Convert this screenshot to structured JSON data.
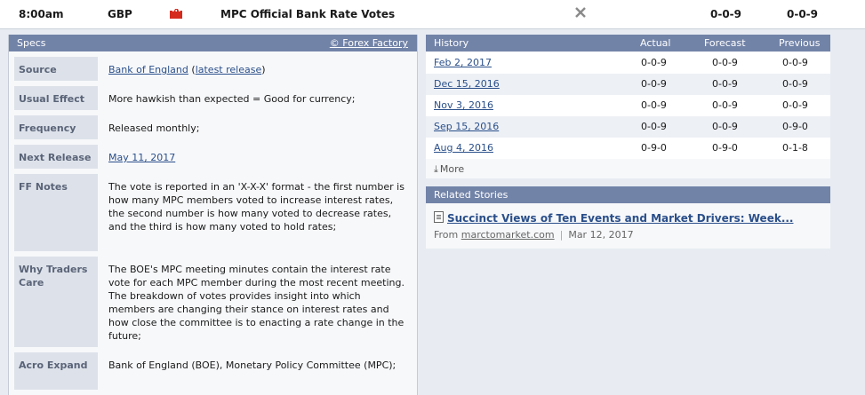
{
  "event": {
    "time": "8:00am",
    "currency": "GBP",
    "impact_color": "#d52b1e",
    "title": "MPC Official Bank Rate Votes",
    "detail_icon": "close-x-icon",
    "actual": "0-0-9",
    "forecast": "0-0-9"
  },
  "specs": {
    "header": "Specs",
    "credit": "© Forex Factory",
    "rows": [
      {
        "label": "Source",
        "link": "Bank of England",
        "open": " (",
        "link2": "latest release",
        "close": ")"
      },
      {
        "label": "Usual Effect",
        "value": "More hawkish than expected = Good for currency;"
      },
      {
        "label": "Frequency",
        "value": "Released monthly;"
      },
      {
        "label": "Next Release",
        "link": "May 11, 2017"
      },
      {
        "label": "FF Notes",
        "value": "The vote is reported in an 'X-X-X' format - the first number is how many MPC members voted to increase interest rates, the second number is how many voted to decrease rates, and the third is how many voted to hold rates;"
      },
      {
        "label": "Why Traders Care",
        "value": "The BOE's MPC meeting minutes contain the interest rate vote for each MPC member during the most recent meeting. The breakdown of votes provides insight into which members are changing their stance on interest rates and how close the committee is to enacting a rate change in the future;"
      },
      {
        "label": "Acro Expand",
        "value": "Bank of England (BOE), Monetary Policy Committee (MPC);"
      }
    ]
  },
  "history": {
    "header": "History",
    "col_actual": "Actual",
    "col_forecast": "Forecast",
    "col_previous": "Previous",
    "rows": [
      {
        "date": "Feb 2, 2017",
        "actual": "0-0-9",
        "forecast": "0-0-9",
        "previous": "0-0-9"
      },
      {
        "date": "Dec 15, 2016",
        "actual": "0-0-9",
        "forecast": "0-0-9",
        "previous": "0-0-9"
      },
      {
        "date": "Nov 3, 2016",
        "actual": "0-0-9",
        "forecast": "0-0-9",
        "previous": "0-0-9"
      },
      {
        "date": "Sep 15, 2016",
        "actual": "0-0-9",
        "forecast": "0-0-9",
        "previous": "0-9-0"
      },
      {
        "date": "Aug 4, 2016",
        "actual": "0-9-0",
        "forecast": "0-9-0",
        "previous": "0-1-8"
      }
    ],
    "more": "More"
  },
  "related": {
    "header": "Related Stories",
    "story_title": "Succinct Views of Ten Events and Market Drivers: Week...",
    "source_prefix": "From ",
    "source": "marctomarket.com",
    "date": "Mar 12, 2017"
  }
}
